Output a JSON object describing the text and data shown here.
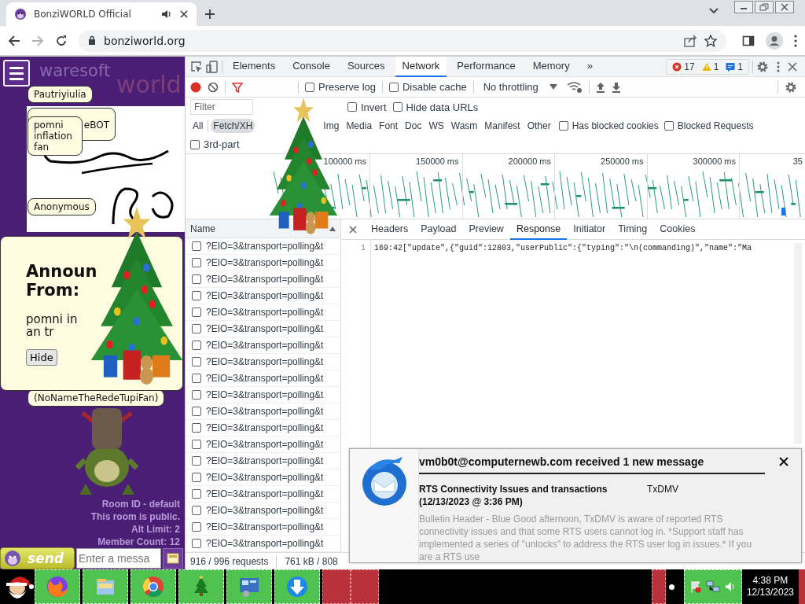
{
  "browser": {
    "tabs": [
      {
        "title": "BonziWORLD Official",
        "selected": true
      }
    ],
    "url": "bonziworld.org"
  },
  "page": {
    "logo": [
      "waresoft",
      "world"
    ],
    "bubbles": [
      {
        "text": "Pautriyiulia"
      },
      {
        "text": "pomni inflation fan"
      },
      {
        "text": "eBOT"
      },
      {
        "text": "Anonymous"
      },
      {
        "text": "(NoNameTheRedeTupiFan)"
      }
    ],
    "announcement": {
      "title_lines": [
        "Announ",
        "From:"
      ],
      "body_lines": [
        "pomni in",
        "an tr"
      ],
      "button": "Hide"
    },
    "room_info": [
      "Room ID - default",
      "This room is public.",
      "Alt Limit: 2",
      "Member Count: 12"
    ],
    "send_button": "send",
    "message_placeholder": "Enter a messa"
  },
  "devtools": {
    "tabs": [
      {
        "label": "Elements",
        "selected": false
      },
      {
        "label": "Console",
        "selected": false
      },
      {
        "label": "Sources",
        "selected": false
      },
      {
        "label": "Network",
        "selected": true
      },
      {
        "label": "Performance",
        "selected": false
      },
      {
        "label": "Memory",
        "selected": false
      }
    ],
    "more_tabs": "»",
    "badges": [
      {
        "kind": "error",
        "count": "17"
      },
      {
        "kind": "warning",
        "count": "1"
      },
      {
        "kind": "message",
        "count": "1"
      }
    ],
    "toolbar": {
      "options": [
        {
          "label": "Preserve log",
          "checked": false
        },
        {
          "label": "Disable cache",
          "checked": false
        }
      ],
      "throttling": "No throttling"
    },
    "filter": {
      "placeholder": "Filter",
      "options": [
        {
          "label": "Invert",
          "checked": false
        },
        {
          "label": "Hide data URLs",
          "checked": false
        }
      ]
    },
    "type_filters": [
      {
        "label": "All",
        "selected": false
      },
      {
        "label": "Fetch/XH",
        "selected": true
      },
      {
        "label": "Img",
        "selected": false
      },
      {
        "label": "Media",
        "selected": false
      },
      {
        "label": "Font",
        "selected": false
      },
      {
        "label": "Doc",
        "selected": false
      },
      {
        "label": "WS",
        "selected": false
      },
      {
        "label": "Wasm",
        "selected": false
      },
      {
        "label": "Manifest",
        "selected": false
      },
      {
        "label": "Other",
        "selected": false
      }
    ],
    "extra_filters": [
      {
        "label": "Has blocked cookies",
        "checked": false
      },
      {
        "label": "Blocked Requests",
        "checked": false
      }
    ],
    "third_party": {
      "label": "3rd-part",
      "checked": false
    },
    "overview": {
      "ticks": [
        "100000 ms",
        "150000 ms",
        "200000 ms",
        "250000 ms",
        "300000 ms",
        "35"
      ]
    },
    "requests": {
      "column": "Name",
      "rows": [
        {
          "name": "?EIO=3&transport=polling&t",
          "checked": false
        },
        {
          "name": "?EIO=3&transport=polling&t",
          "checked": false
        },
        {
          "name": "?EIO=3&transport=polling&t",
          "checked": false
        },
        {
          "name": "?EIO=3&transport=polling&t",
          "checked": false
        },
        {
          "name": "?EIO=3&transport=polling&t",
          "checked": false
        },
        {
          "name": "?EIO=3&transport=polling&t",
          "checked": false
        },
        {
          "name": "?EIO=3&transport=polling&t",
          "checked": false
        },
        {
          "name": "?EIO=3&transport=polling&t",
          "checked": false
        },
        {
          "name": "?EIO=3&transport=polling&t",
          "checked": false
        },
        {
          "name": "?EIO=3&transport=polling&t",
          "checked": false
        },
        {
          "name": "?EIO=3&transport=polling&t",
          "checked": false
        },
        {
          "name": "?EIO=3&transport=polling&t",
          "checked": false
        },
        {
          "name": "?EIO=3&transport=polling&t",
          "checked": false
        },
        {
          "name": "?EIO=3&transport=polling&t",
          "checked": false
        },
        {
          "name": "?EIO=3&transport=polling&t",
          "checked": false
        },
        {
          "name": "?EIO=3&transport=polling&t",
          "checked": false
        },
        {
          "name": "?EIO=3&transport=polling&t",
          "checked": false
        },
        {
          "name": "?EIO=3&transport=polling&t",
          "checked": false
        },
        {
          "name": "?EIO=3&transport=polling&t",
          "checked": false
        }
      ]
    },
    "detail_tabs": [
      {
        "label": "Headers",
        "selected": false
      },
      {
        "label": "Payload",
        "selected": false
      },
      {
        "label": "Preview",
        "selected": false
      },
      {
        "label": "Response",
        "selected": true
      },
      {
        "label": "Initiator",
        "selected": false
      },
      {
        "label": "Timing",
        "selected": false
      },
      {
        "label": "Cookies",
        "selected": false
      }
    ],
    "response": {
      "lines": [
        {
          "number": "1",
          "text": "169:42[\"update\",{\"guid\":12803,\"userPublic\":{\"typing\":\"\\n(commanding)\",\"name\":\"Ma"
        }
      ]
    },
    "status": [
      "916 / 996 requests",
      "761 kB / 808"
    ]
  },
  "notification": {
    "title": "vm0b0t@computernewb.com received 1 new message",
    "subject": "RTS Connectivity Issues and transactions",
    "sender": "TxDMV",
    "date": "(12/13/2023 @ 3:36 PM)",
    "preview": "Bulletin Header - Blue Good afternoon, TxDMV is aware of reported RTS connectivity issues and that some RTS users cannot log in. *Support staff has implemented a series of \"unlocks\" to address the RTS user log in issues.* If you are a RTS use"
  },
  "taskbar": {
    "time": "4:38 PM",
    "date": "12/13/2023"
  }
}
